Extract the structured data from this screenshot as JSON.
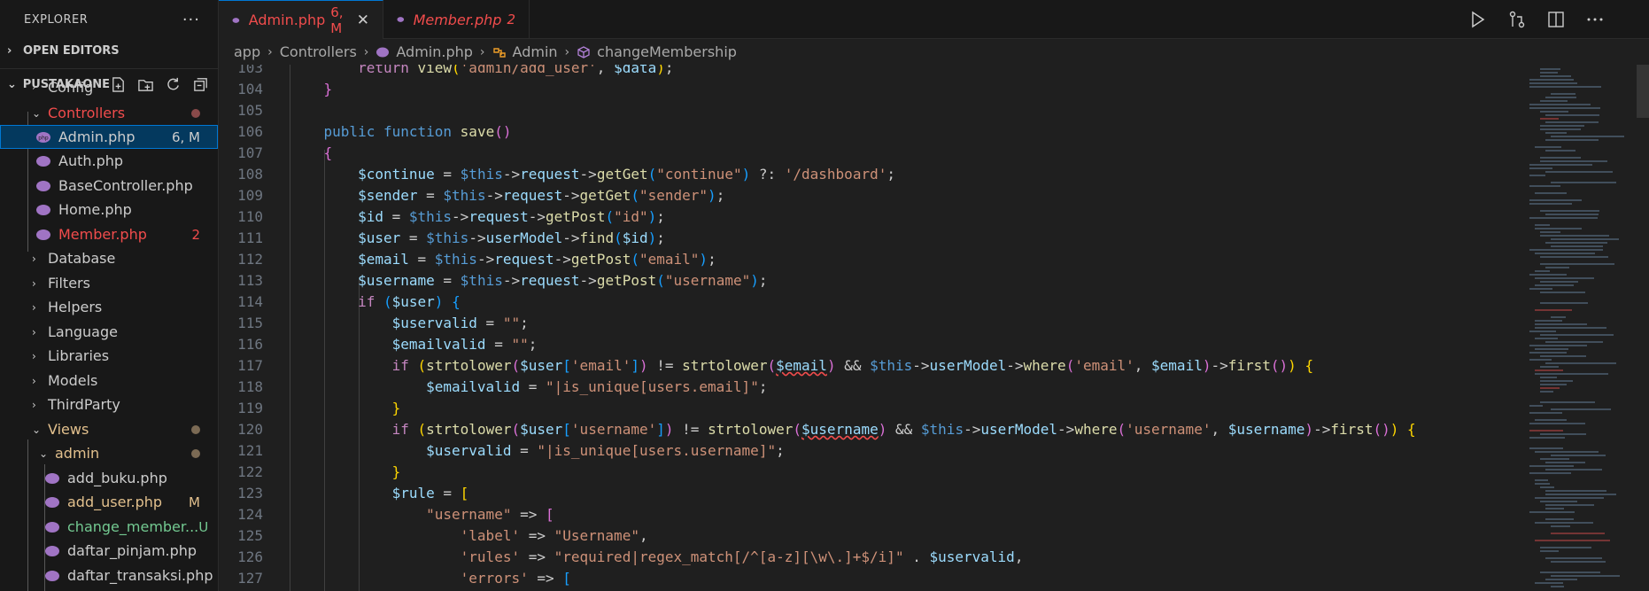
{
  "explorer": {
    "title": "EXPLORER",
    "more": "···",
    "open_editors": "OPEN EDITORS",
    "project": "PUSTAKAONE",
    "items": [
      {
        "label": "Config",
        "kind": "folder",
        "color": "#cccccc"
      },
      {
        "label": "Controllers",
        "kind": "folder-open",
        "color": "#f14c4c"
      },
      {
        "label": "Admin.php",
        "kind": "file",
        "status": "6, M",
        "color": "#cccccc"
      },
      {
        "label": "Auth.php",
        "kind": "file",
        "color": "#cccccc"
      },
      {
        "label": "BaseController.php",
        "kind": "file",
        "color": "#cccccc"
      },
      {
        "label": "Home.php",
        "kind": "file",
        "color": "#cccccc"
      },
      {
        "label": "Member.php",
        "kind": "file",
        "status": "2",
        "color": "#f14c4c"
      },
      {
        "label": "Database",
        "kind": "folder",
        "color": "#cccccc"
      },
      {
        "label": "Filters",
        "kind": "folder",
        "color": "#cccccc"
      },
      {
        "label": "Helpers",
        "kind": "folder",
        "color": "#cccccc"
      },
      {
        "label": "Language",
        "kind": "folder",
        "color": "#cccccc"
      },
      {
        "label": "Libraries",
        "kind": "folder",
        "color": "#cccccc"
      },
      {
        "label": "Models",
        "kind": "folder",
        "color": "#cccccc"
      },
      {
        "label": "ThirdParty",
        "kind": "folder",
        "color": "#cccccc"
      },
      {
        "label": "Views",
        "kind": "folder-open",
        "color": "#e2c08d"
      },
      {
        "label": "admin",
        "kind": "folder-open",
        "color": "#e2c08d"
      },
      {
        "label": "add_buku.php",
        "kind": "file",
        "color": "#cccccc"
      },
      {
        "label": "add_user.php",
        "kind": "file",
        "status": "M",
        "color": "#e2c08d"
      },
      {
        "label": "change_member...",
        "kind": "file",
        "status": "U",
        "color": "#73c991"
      },
      {
        "label": "daftar_pinjam.php",
        "kind": "file",
        "color": "#cccccc"
      },
      {
        "label": "daftar_transaksi.php",
        "kind": "file",
        "color": "#cccccc"
      }
    ]
  },
  "tabs": [
    {
      "name": "Admin.php",
      "count": "6, M",
      "close": "✕",
      "active": true
    },
    {
      "name": "Member.php",
      "count": "2",
      "active": false
    }
  ],
  "breadcrumb": {
    "items": [
      "app",
      "Controllers",
      "Admin.php",
      "Admin",
      "changeMembership"
    ]
  },
  "code_lines": [
    103,
    104,
    105,
    106,
    107,
    108,
    109,
    110,
    111,
    112,
    113,
    114,
    115,
    116,
    117,
    118,
    119,
    120,
    121,
    122,
    123,
    124,
    125,
    126,
    127
  ],
  "colors": {
    "accent": "#0078d4",
    "error": "#f14c4c",
    "modified": "#e2c08d",
    "untracked": "#73c991",
    "php_icon": "#a074c4"
  }
}
